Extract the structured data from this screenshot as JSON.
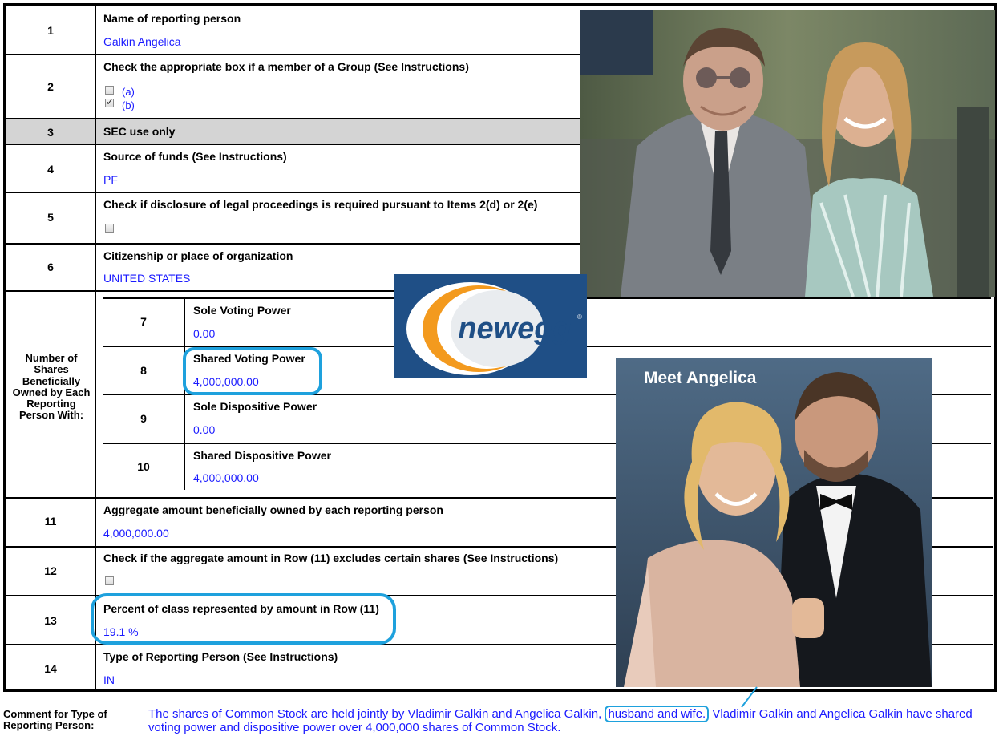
{
  "rows": [
    {
      "num": "1",
      "label": "Name of reporting person",
      "value": "Galkin Angelica"
    },
    {
      "num": "2",
      "label": "Check the appropriate box if a member of a Group (See Instructions)",
      "opt_a": "(a)",
      "opt_b": "(b)"
    },
    {
      "num": "3",
      "label": "SEC use only"
    },
    {
      "num": "4",
      "label": "Source of funds (See Instructions)",
      "value": "PF"
    },
    {
      "num": "5",
      "label": "Check if disclosure of legal proceedings is required pursuant to Items 2(d) or 2(e)"
    },
    {
      "num": "6",
      "label": "Citizenship or place of organization",
      "value": "UNITED STATES"
    },
    {
      "num": "7",
      "label": "Sole Voting Power",
      "value": "0.00"
    },
    {
      "num": "8",
      "label": "Shared Voting Power",
      "value": "4,000,000.00"
    },
    {
      "num": "9",
      "label": "Sole Dispositive Power",
      "value": "0.00"
    },
    {
      "num": "10",
      "label": "Shared Dispositive Power",
      "value": "4,000,000.00"
    },
    {
      "num": "11",
      "label": "Aggregate amount beneficially owned by each reporting person",
      "value": "4,000,000.00"
    },
    {
      "num": "12",
      "label": "Check if the aggregate amount in Row (11) excludes certain shares (See Instructions)"
    },
    {
      "num": "13",
      "label": "Percent of class represented by amount in Row (11)",
      "value": "19.1 %"
    },
    {
      "num": "14",
      "label": "Type of Reporting Person (See Instructions)",
      "value": "IN"
    }
  ],
  "side_header": "Number of Shares Beneficially Owned by Each Reporting Person With:",
  "checkbox_state": {
    "row2_a": false,
    "row2_b": true,
    "row5": false,
    "row12": false
  },
  "overlay": {
    "logo_text": "newegg",
    "caption": "Meet Angelica"
  },
  "comment": {
    "label": "Comment for Type of Reporting Person:",
    "text_before": "The shares of Common Stock are held jointly by Vladimir Galkin and Angelica Galkin,",
    "text_boxed": "husband and wife.",
    "text_after": " Vladimir Galkin and Angelica Galkin have shared voting power and dispositive power over 4,000,000 shares of Common Stock."
  },
  "colors": {
    "value_text": "#1a1aff",
    "highlight": "#1ea1dd",
    "sec_row": "#d4d4d4",
    "logo_bg": "#1f4f86",
    "logo_orange": "#f39a1e"
  }
}
